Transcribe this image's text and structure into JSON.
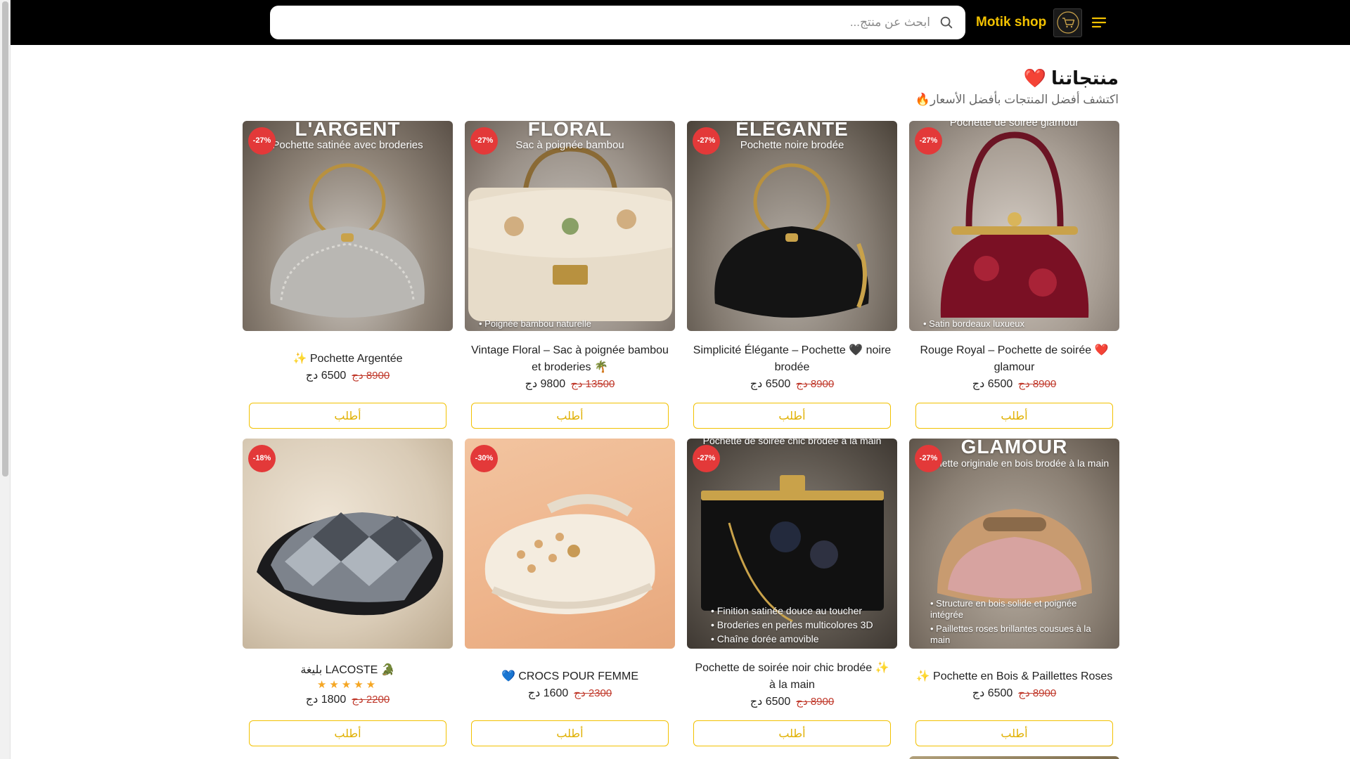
{
  "header": {
    "search_placeholder": "ابحث عن منتج...",
    "brand_name": "Motik shop",
    "logo_text": "Motik shop"
  },
  "section": {
    "title": "منتجاتنا ❤️",
    "subtitle": "اكتشف أفضل المنتجات بأفضل الأسعار🔥"
  },
  "products": [
    {
      "discount": "-27%",
      "image_title": "L'ARGENT",
      "image_sub": "Pochette satinée avec broderies",
      "name": "✨ Pochette Argentée",
      "price": "6500 دج",
      "old_price": "8900 دج",
      "order_label": "أطلب"
    },
    {
      "discount": "-27%",
      "image_title": "FLORAL",
      "image_sub": "Sac à poignée bambou",
      "image_bottom": "• Poignée bambou naturelle",
      "name": "Vintage Floral – Sac à poignée bambou et broderies 🌴",
      "price": "9800 دج",
      "old_price": "13500 دج",
      "order_label": "أطلب"
    },
    {
      "discount": "-27%",
      "image_title": "ÉLÉGANTE",
      "image_sub": "Pochette noire brodée",
      "name": "Simplicité Élégante – Pochette 🖤 noire brodée",
      "price": "6500 دج",
      "old_price": "8900 دج",
      "order_label": "أطلب"
    },
    {
      "discount": "-27%",
      "image_sub": "Pochette de soirée glamour",
      "image_bottom": "• Satin bordeaux luxueux",
      "name": "Rouge Royal – Pochette de soirée ❤️ glamour",
      "price": "6500 دج",
      "old_price": "8900 دج",
      "order_label": "أطلب"
    },
    {
      "discount": "-18%",
      "name": "بليغة LACOSTE 🐊",
      "stars": "★★★★★",
      "rating": 5,
      "price": "1800 دج",
      "old_price": "2200 دج",
      "order_label": "أطلب"
    },
    {
      "discount": "-30%",
      "name": "💙 CROCS POUR FEMME",
      "price": "1600 دج",
      "old_price": "2300 دج",
      "order_label": "أطلب"
    },
    {
      "discount": "-27%",
      "image_sub": "Pochette de soirée chic brodée à la main",
      "image_bullets": [
        "• Finition satinée douce au toucher",
        "• Broderies en perles multicolores 3D",
        "• Chaîne dorée amovible"
      ],
      "name": "Pochette de soirée noir chic brodée ✨ à la main",
      "price": "6500 دج",
      "old_price": "8900 دج",
      "order_label": "أطلب"
    },
    {
      "discount": "-27%",
      "image_title": "GLAMOUR",
      "image_sub": "Pochette originale en bois brodée à la main",
      "image_bullets": [
        "• Structure en bois solide et poignée intégrée",
        "• Paillettes roses brillantes cousues à la main"
      ],
      "name": "✨ Pochette en Bois & Paillettes Roses",
      "price": "6500 دج",
      "old_price": "8900 دج",
      "order_label": "أطلب"
    }
  ],
  "colors": {
    "accent": "#f2c100",
    "discount_badge": "#e33939",
    "old_price": "#c0392b",
    "header_bg": "#000000"
  }
}
